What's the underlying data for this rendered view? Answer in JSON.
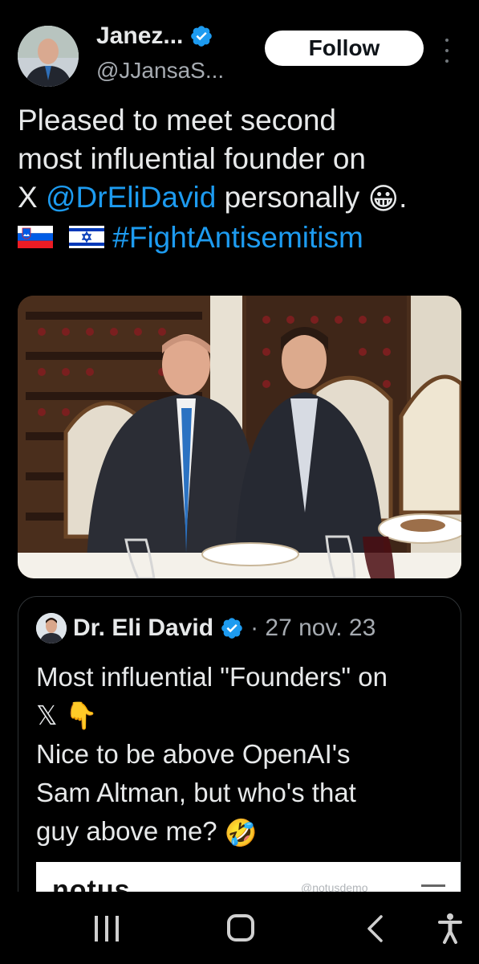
{
  "author": {
    "name": "Janez...",
    "handle": "@JJansaS...",
    "follow_label": "Follow"
  },
  "tweet": {
    "text_line1": "Pleased to meet second",
    "text_line2": "most influential founder on",
    "text_line3_prefix": "X ",
    "mention": "@DrEliDavid",
    "text_line3_suffix": " personally ",
    "emoji_grin": "😀",
    "period": ".",
    "hashtag": "#FightAntisemitism"
  },
  "quoted": {
    "name": "Dr. Eli David",
    "meta": "· 27 nov. 23",
    "line1": "Most influential \"Founders\" on",
    "line2": "𝕏 👇",
    "line3": "Nice to be above OpenAI's",
    "line4": "Sam Altman, but who's that",
    "line5_text": "guy above me? ",
    "line5_emoji": "🤣",
    "card_logo": "notus",
    "card_handle": "@notusdemo"
  },
  "colors": {
    "background": "#000000",
    "accent": "#1d9bf0",
    "text": "#e7e9ea",
    "muted": "#a6abb1"
  },
  "icons": {
    "verified": "verified-badge-icon",
    "more": "more-vertical-icon",
    "nav_recents": "recents-icon",
    "nav_home": "home-icon",
    "nav_back": "back-chevron-icon",
    "nav_accessibility": "accessibility-icon"
  }
}
